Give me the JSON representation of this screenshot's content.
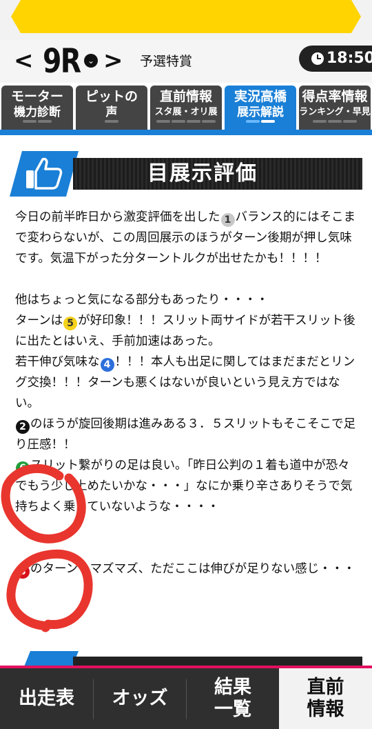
{
  "header": {
    "prev_arrow": "<",
    "race_number": "9R",
    "race_dropdown": "⌄",
    "next_arrow": ">",
    "race_name": "予選特賞",
    "time": "18:50"
  },
  "tabs": [
    {
      "line1": "モーター",
      "line2": "機力診断",
      "active": false
    },
    {
      "line1": "ピットの",
      "line2": "声",
      "active": false
    },
    {
      "line1": "直前情報",
      "line2": "スタ展・オリ展",
      "active": false
    },
    {
      "line1": "実況高橋",
      "line2": "展示解説",
      "active": true
    },
    {
      "line1": "得点率情報",
      "line2": "ランキング・早見",
      "active": false
    }
  ],
  "section": {
    "title": "目展示評価"
  },
  "article": {
    "p1_a": "今日の前半昨日から激変評価を出した",
    "p1_n": "1",
    "p1_b": "バランス的にはそこまで変わらないが、この周回展示のほうがターン後期が押し気味です。気温下がった分ターントルクが出せたかも！！！！",
    "p2": "他はちょっと気になる部分もあったり・・・・",
    "p3_a": "ターンは",
    "p3_n": "5",
    "p3_b": "が好印象！！！スリット両サイドが若干スリット後に出たとはいえ、手前加速はあった。",
    "p4_a": "若干伸び気味な",
    "p4_n": "4",
    "p4_b": "！！！本人も出足に関してはまだまだとリング交換！！！ターンも悪くはないが良いという見え方ではない。",
    "p5_n": "2",
    "p5_b": "のほうが旋回後期は進みある３．５スリットもそこそこで足り圧感！！",
    "p6_n": "6",
    "p6_b": "スリット繋がりの足は良い。「昨日公判の１着も道中が恐々でもう少し上めたいかな・・・」なにか乗り辛さありそうで気持ちよく乗っていないような・・・・",
    "p7_n": "3",
    "p7_b": "のターンもマズマズ、ただここは伸びが足りない感じ・・・"
  },
  "bottom_nav": [
    {
      "label": "出走表",
      "active": false
    },
    {
      "label": "オッズ",
      "active": false
    },
    {
      "label": "結果\n一覧",
      "active": false
    },
    {
      "label": "直前\n情報",
      "active": true
    }
  ],
  "colors": {
    "accent_blue": "#1a7fd6",
    "banner_yellow": "#ffd400",
    "nav_pink": "#e2105e",
    "annotation_red": "#e8362e"
  }
}
